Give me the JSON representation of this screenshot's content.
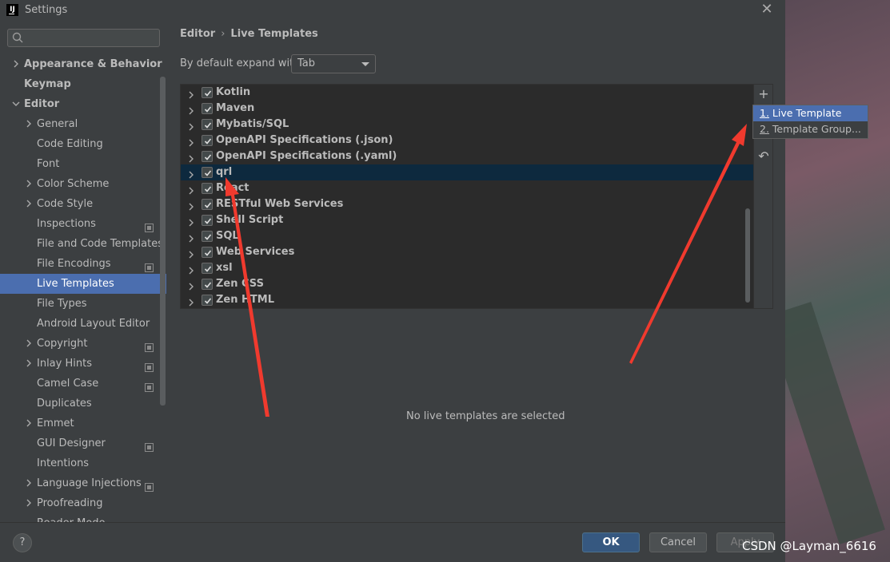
{
  "window": {
    "title": "Settings"
  },
  "sidebar": {
    "items": [
      {
        "label": "Appearance & Behavior",
        "level": 0,
        "expandable": true,
        "bold": true
      },
      {
        "label": "Keymap",
        "level": 0,
        "expandable": false,
        "bold": true
      },
      {
        "label": "Editor",
        "level": 0,
        "expandable": true,
        "expanded": true,
        "bold": true
      },
      {
        "label": "General",
        "level": 1,
        "expandable": true
      },
      {
        "label": "Code Editing",
        "level": 1
      },
      {
        "label": "Font",
        "level": 1
      },
      {
        "label": "Color Scheme",
        "level": 1,
        "expandable": true
      },
      {
        "label": "Code Style",
        "level": 1,
        "expandable": true
      },
      {
        "label": "Inspections",
        "level": 1,
        "project": true
      },
      {
        "label": "File and Code Templates",
        "level": 1
      },
      {
        "label": "File Encodings",
        "level": 1,
        "project": true
      },
      {
        "label": "Live Templates",
        "level": 1,
        "selected": true
      },
      {
        "label": "File Types",
        "level": 1
      },
      {
        "label": "Android Layout Editor",
        "level": 1
      },
      {
        "label": "Copyright",
        "level": 1,
        "expandable": true,
        "project": true
      },
      {
        "label": "Inlay Hints",
        "level": 1,
        "expandable": true,
        "project": true
      },
      {
        "label": "Camel Case",
        "level": 1,
        "project": true
      },
      {
        "label": "Duplicates",
        "level": 1
      },
      {
        "label": "Emmet",
        "level": 1,
        "expandable": true
      },
      {
        "label": "GUI Designer",
        "level": 1,
        "project": true
      },
      {
        "label": "Intentions",
        "level": 1
      },
      {
        "label": "Language Injections",
        "level": 1,
        "expandable": true,
        "project": true
      },
      {
        "label": "Proofreading",
        "level": 1,
        "expandable": true
      },
      {
        "label": "Reader Mode",
        "level": 1,
        "project": true
      }
    ]
  },
  "main": {
    "breadcrumb": {
      "parent": "Editor",
      "current": "Live Templates"
    },
    "expand_label": "By default expand with",
    "expand_value": "Tab",
    "groups": [
      {
        "label": "Kotlin",
        "checked": true
      },
      {
        "label": "Maven",
        "checked": true
      },
      {
        "label": "Mybatis/SQL",
        "checked": true
      },
      {
        "label": "OpenAPI Specifications (.json)",
        "checked": true
      },
      {
        "label": "OpenAPI Specifications (.yaml)",
        "checked": true
      },
      {
        "label": "qrl",
        "checked": true,
        "selected": true
      },
      {
        "label": "React",
        "checked": true
      },
      {
        "label": "RESTful Web Services",
        "checked": true
      },
      {
        "label": "Shell Script",
        "checked": true
      },
      {
        "label": "SQL",
        "checked": true
      },
      {
        "label": "Web Services",
        "checked": true
      },
      {
        "label": "xsl",
        "checked": true
      },
      {
        "label": "Zen CSS",
        "checked": true
      },
      {
        "label": "Zen HTML",
        "checked": true
      }
    ],
    "toolbar": {
      "add_glyph": "+",
      "restore_glyph": "↶"
    },
    "popup": [
      {
        "num": "1.",
        "label": "Live Template"
      },
      {
        "num": "2.",
        "label": "Template Group..."
      }
    ],
    "empty_message": "No live templates are selected"
  },
  "footer": {
    "help": "?",
    "ok": "OK",
    "cancel": "Cancel",
    "apply": "Apply"
  },
  "watermark": "CSDN @Layman_6616",
  "colors": {
    "background": "#3c3f41",
    "selection": "#4b6eaf",
    "list_selection": "#0d293e",
    "annotation_arrow": "#f03a2e"
  }
}
